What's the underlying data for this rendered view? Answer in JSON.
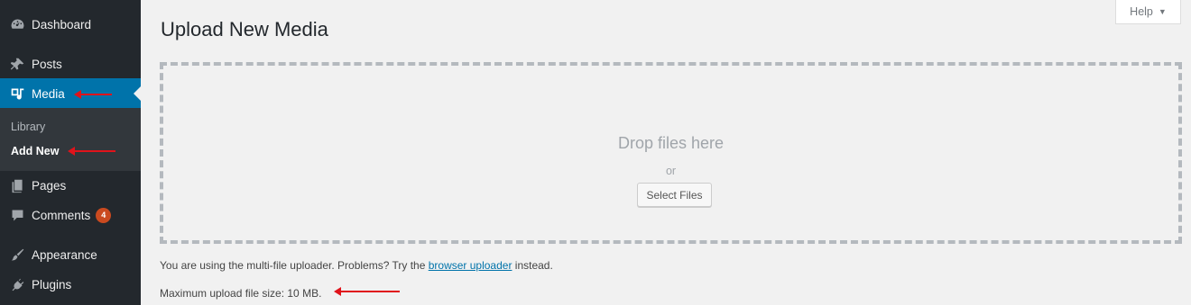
{
  "sidebar": {
    "items": [
      {
        "label": "Dashboard",
        "icon": "dashboard-icon"
      },
      {
        "label": "Posts",
        "icon": "pushpin-icon"
      },
      {
        "label": "Media",
        "icon": "media-icon"
      },
      {
        "label": "Pages",
        "icon": "pages-icon"
      },
      {
        "label": "Comments",
        "icon": "comments-icon",
        "badge": "4"
      },
      {
        "label": "Appearance",
        "icon": "paintbrush-icon"
      },
      {
        "label": "Plugins",
        "icon": "plugin-icon"
      }
    ],
    "submenu": [
      {
        "label": "Library"
      },
      {
        "label": "Add New"
      }
    ]
  },
  "header": {
    "title": "Upload New Media",
    "help_label": "Help",
    "help_caret": "▼"
  },
  "uploader": {
    "drop_text": "Drop files here",
    "or_text": "or",
    "select_files_label": "Select Files"
  },
  "notice": {
    "before_link": "You are using the multi-file uploader. Problems? Try the ",
    "link_text": "browser uploader",
    "after_link": " instead."
  },
  "max_upload": "Maximum upload file size: 10 MB.",
  "colors": {
    "sidebar_bg": "#23282d",
    "submenu_bg": "#32373c",
    "accent": "#0073aa",
    "badge": "#ca4a1f",
    "annotation_arrow": "#e0131b"
  }
}
